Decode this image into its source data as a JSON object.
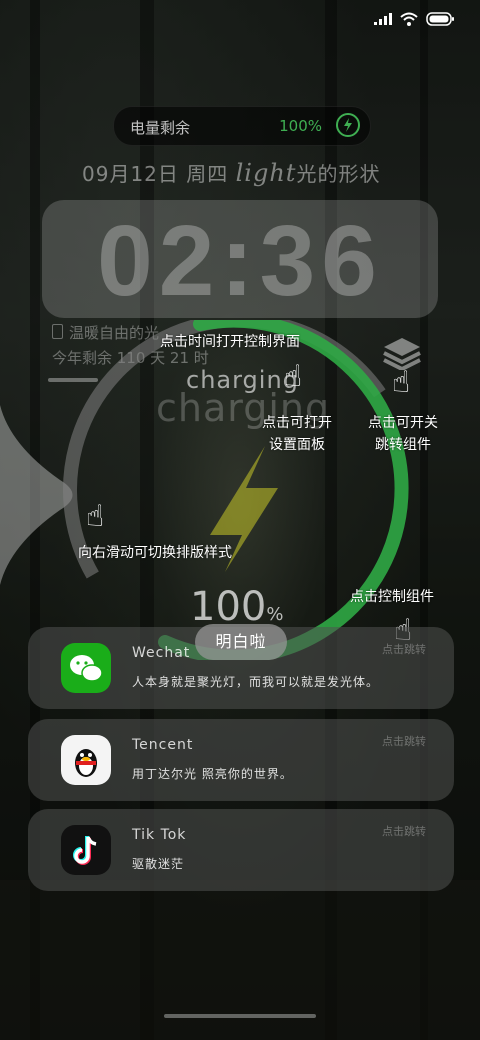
{
  "battery_widget": {
    "label": "电量剩余",
    "percent": "100%"
  },
  "date_line": {
    "date": "09月12日",
    "weekday": "周四",
    "script": "light",
    "suffix": "光的形状"
  },
  "clock": "02:36",
  "quote": {
    "line1": "温暖自由的光",
    "line2": "今年剩余 110 天 21 时"
  },
  "charging": {
    "small": "charging",
    "big": "charging",
    "percent": "100",
    "percent_unit": "%",
    "level": 1.0
  },
  "colors": {
    "accent_green": "#3fae52",
    "ring_gray": "#8a8a8a"
  },
  "hints": {
    "open_control": "点击时间打开控制界面",
    "open_settings_line1": "点击可打开",
    "open_settings_line2": "设置面板",
    "toggle_line1": "点击可开关",
    "toggle_line2": "跳转组件",
    "swipe_layout": "向右滑动可切换排版样式",
    "control_widget": "点击控制组件"
  },
  "confirm_button": "明白啦",
  "notifications": [
    {
      "app": "Wechat",
      "message": "人本身就是聚光灯，而我可以就是发光体。",
      "tag": "点击跳转",
      "icon": "wechat-icon"
    },
    {
      "app": "Tencent",
      "message": "用丁达尔光 照亮你的世界。",
      "tag": "点击跳转",
      "icon": "qq-penguin-icon"
    },
    {
      "app": "Tik Tok",
      "message": "驱散迷茫",
      "tag": "点击跳转",
      "icon": "tiktok-icon"
    }
  ],
  "status_icons": [
    "signal-icon",
    "wifi-icon",
    "battery-icon"
  ]
}
